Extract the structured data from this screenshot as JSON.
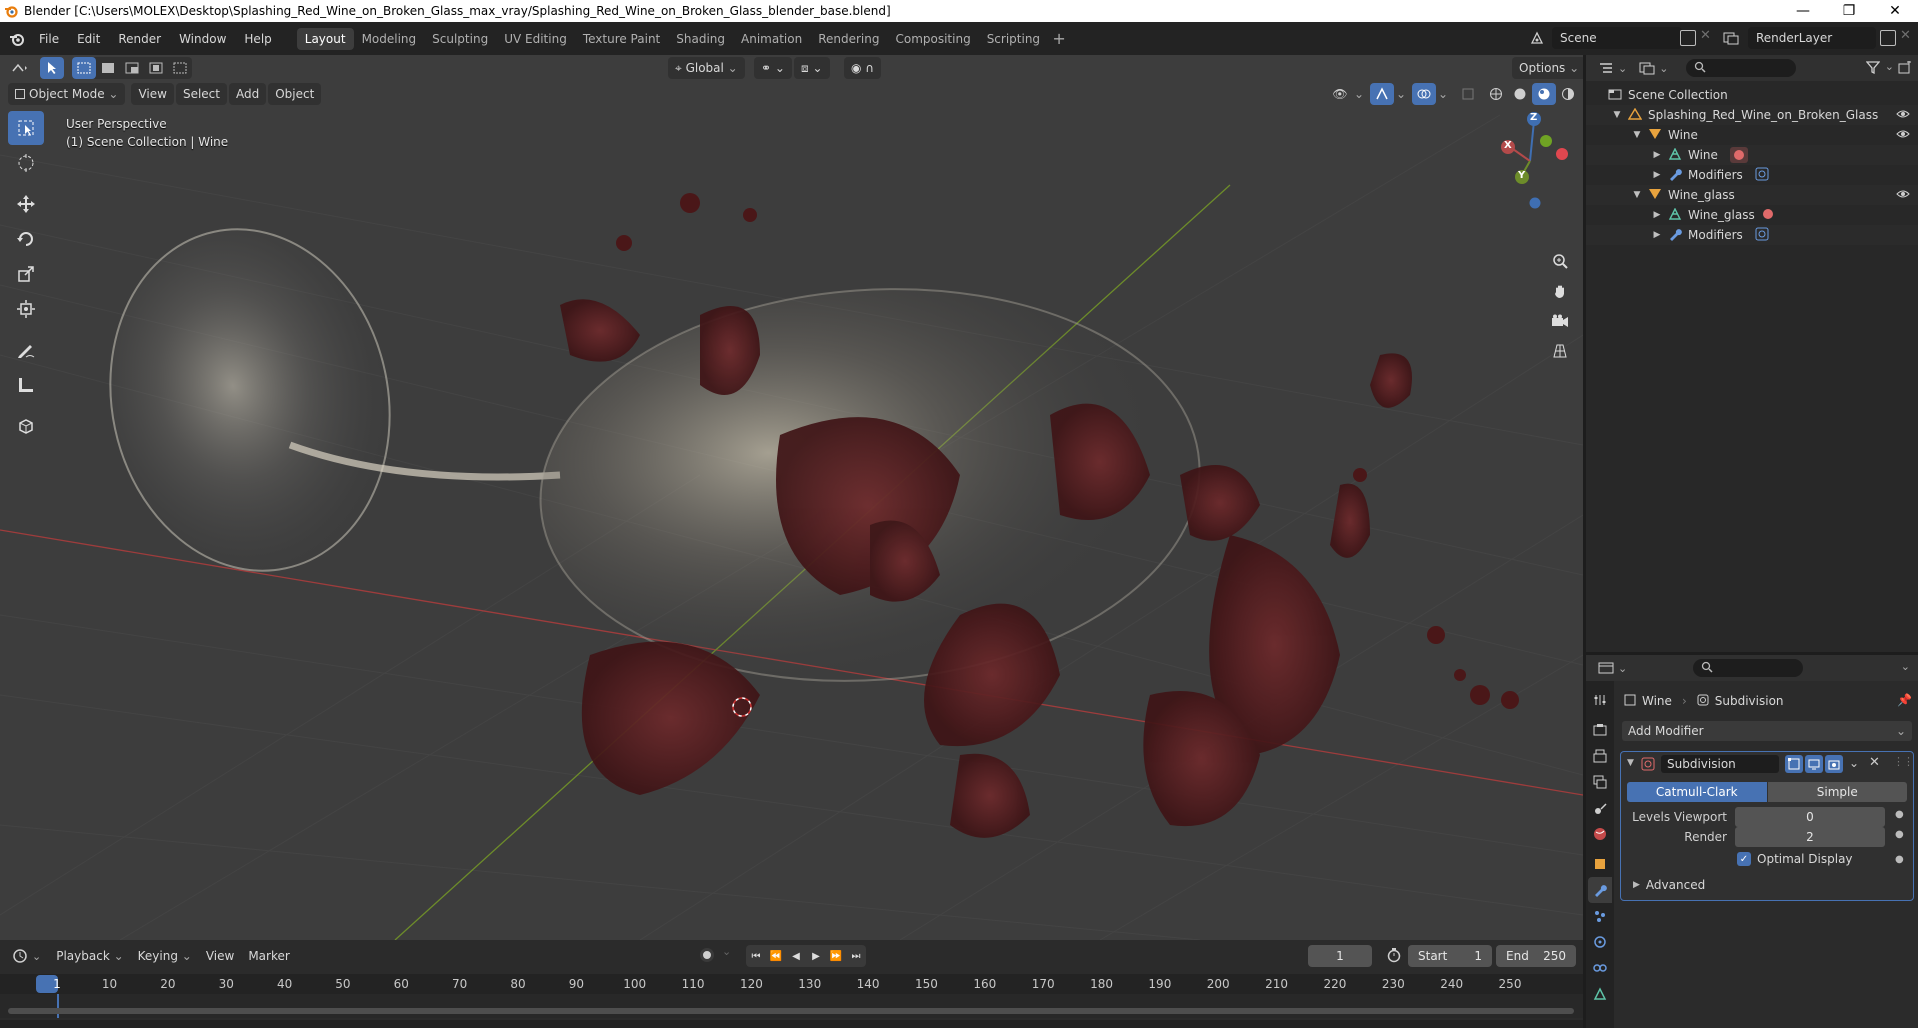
{
  "window": {
    "title": "Blender [C:\\Users\\MOLEX\\Desktop\\Splashing_Red_Wine_on_Broken_Glass_max_vray/Splashing_Red_Wine_on_Broken_Glass_blender_base.blend]",
    "controls": [
      "minimize-icon",
      "maximize-icon",
      "close-icon"
    ]
  },
  "menu": {
    "items": [
      "File",
      "Edit",
      "Render",
      "Window",
      "Help"
    ]
  },
  "workspaces": {
    "tabs": [
      "Layout",
      "Modeling",
      "Sculpting",
      "UV Editing",
      "Texture Paint",
      "Shading",
      "Animation",
      "Rendering",
      "Compositing",
      "Scripting"
    ],
    "active": "Layout"
  },
  "scene": {
    "name": "Scene"
  },
  "view_layer": {
    "name": "RenderLayer"
  },
  "viewport": {
    "mode": "Object Mode",
    "menus": [
      "View",
      "Select",
      "Add",
      "Object"
    ],
    "transform_orientation": "Global",
    "options_label": "Options",
    "view_name": "User Perspective",
    "collection_info": "(1) Scene Collection | Wine",
    "axes": {
      "x": "X",
      "y": "Y",
      "z": "Z"
    },
    "colors": {
      "x_axis": "#b34a4a",
      "y_axis": "#6d8c2a",
      "accent": "#4772b3",
      "wine": "#5a1c1e"
    }
  },
  "timeline": {
    "menus": [
      "Playback",
      "Keying",
      "View",
      "Marker"
    ],
    "current_frame": "1",
    "start_label": "Start",
    "start_value": "1",
    "end_label": "End",
    "end_value": "250",
    "ruler_labels": [
      "1",
      "10",
      "20",
      "30",
      "40",
      "50",
      "60",
      "70",
      "80",
      "90",
      "100",
      "110",
      "120",
      "130",
      "140",
      "150",
      "160",
      "170",
      "180",
      "190",
      "200",
      "210",
      "220",
      "230",
      "240",
      "250"
    ]
  },
  "outliner": {
    "root": "Scene Collection",
    "items": [
      {
        "label": "Splashing_Red_Wine_on_Broken_Glass",
        "indent": 1,
        "icon": "collection-icon"
      },
      {
        "label": "Wine",
        "indent": 2,
        "icon": "object-icon"
      },
      {
        "label": "Wine",
        "indent": 3,
        "icon": "mesh-data-icon"
      },
      {
        "label": "Modifiers",
        "indent": 3,
        "icon": "wrench-icon"
      },
      {
        "label": "Wine_glass",
        "indent": 2,
        "icon": "object-icon"
      },
      {
        "label": "Wine_glass",
        "indent": 3,
        "icon": "mesh-data-icon"
      },
      {
        "label": "Modifiers",
        "indent": 3,
        "icon": "wrench-icon"
      }
    ]
  },
  "properties": {
    "breadcrumb_object": "Wine",
    "breadcrumb_modifier": "Subdivision",
    "add_modifier": "Add Modifier",
    "modifier": {
      "name": "Subdivision",
      "type_options": [
        "Catmull-Clark",
        "Simple"
      ],
      "type_selected": "Catmull-Clark",
      "levels_viewport_label": "Levels Viewport",
      "levels_viewport_value": "0",
      "render_label": "Render",
      "render_value": "2",
      "optimal_display_label": "Optimal Display",
      "optimal_display_checked": true,
      "advanced_label": "Advanced"
    }
  }
}
